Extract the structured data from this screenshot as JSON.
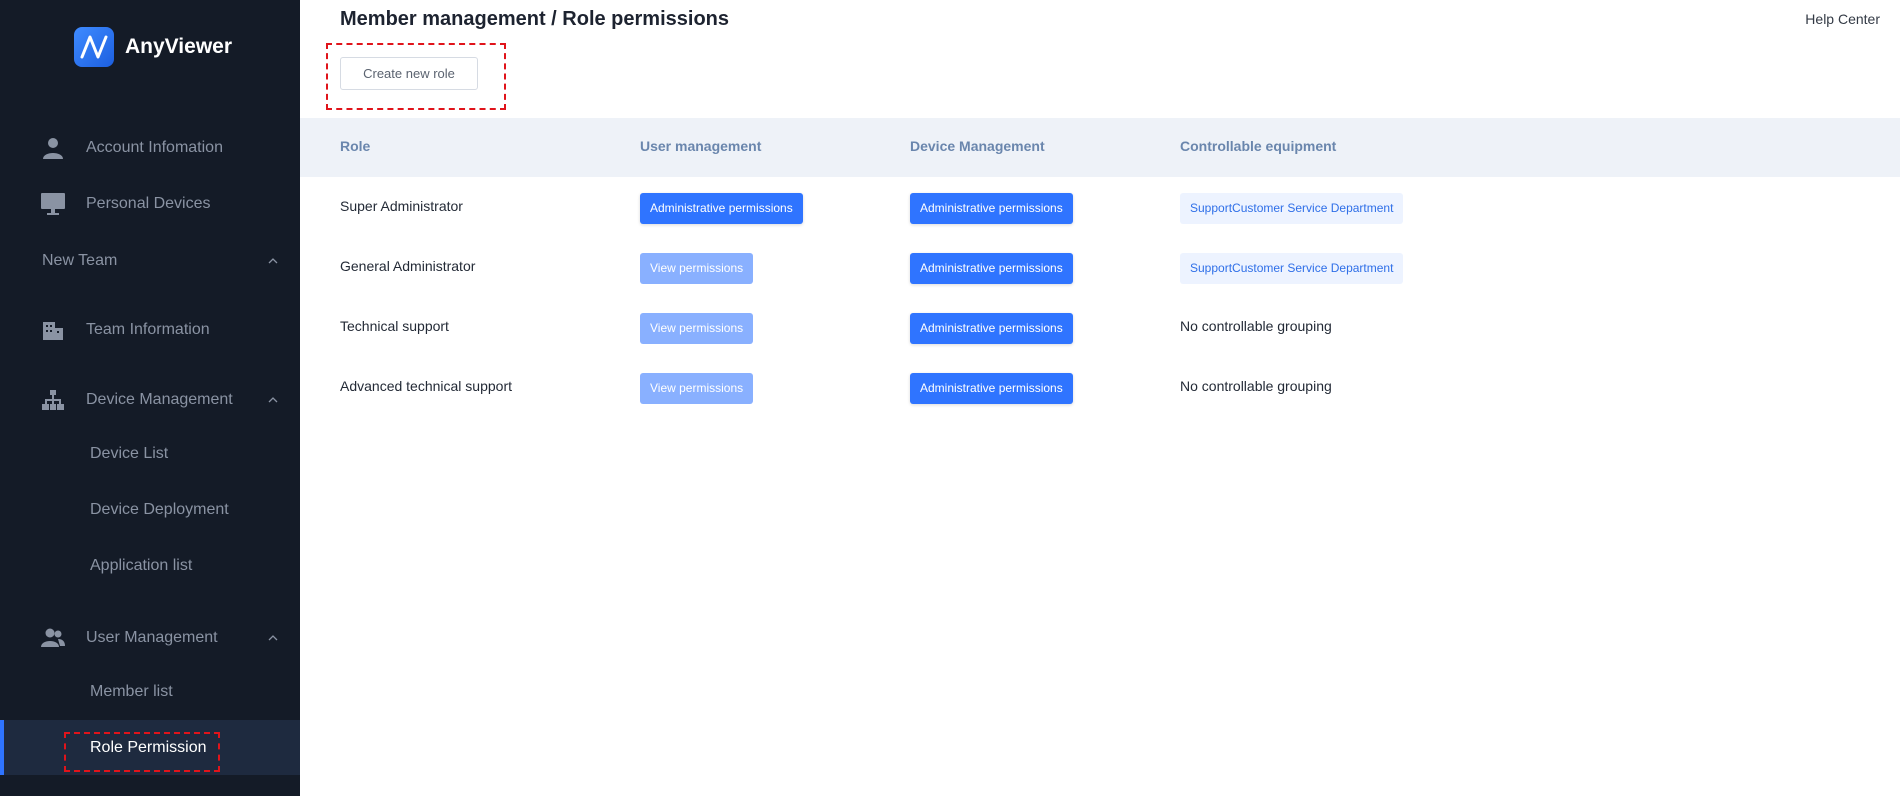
{
  "app": {
    "name": "AnyViewer"
  },
  "sidebar": {
    "account_info": "Account Infomation",
    "personal_devices": "Personal Devices",
    "team_group": "New Team",
    "team_information": "Team Information",
    "device_management": "Device Management",
    "device_list": "Device List",
    "device_deployment": "Device Deployment",
    "application_list": "Application list",
    "user_management": "User Management",
    "member_list": "Member list",
    "role_permission": "Role Permission"
  },
  "header": {
    "title": "Member management / Role permissions",
    "help": "Help Center"
  },
  "toolbar": {
    "create_label": "Create new role"
  },
  "table": {
    "columns": [
      "Role",
      "User management",
      "Device Management",
      "Controllable equipment"
    ],
    "rows": [
      {
        "role": "Super Administrator",
        "user_mgmt": "Administrative permissions",
        "device_mgmt": "Administrative permissions",
        "equipment": "SupportCustomer Service Department"
      },
      {
        "role": "General Administrator",
        "user_mgmt": "View permissions",
        "device_mgmt": "Administrative permissions",
        "equipment": "SupportCustomer Service Department"
      },
      {
        "role": "Technical support",
        "user_mgmt": "View permissions",
        "device_mgmt": "Administrative permissions",
        "equipment": "No controllable grouping"
      },
      {
        "role": "Advanced technical support",
        "user_mgmt": "View permissions",
        "device_mgmt": "Administrative permissions",
        "equipment": "No controllable grouping"
      }
    ]
  },
  "colors": {
    "sidebar_bg": "#141b27",
    "accent": "#2f74ff",
    "highlight_box": "#e0141b"
  }
}
